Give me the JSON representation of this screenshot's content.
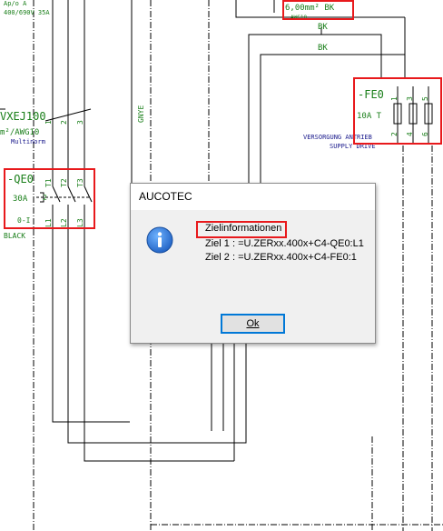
{
  "schematic": {
    "top_partial_1": "Ap/o A",
    "top_partial_2": "400/690V 35A",
    "wire_size": "6,00mm² BK",
    "wire_awg": "AWG10",
    "bk_1": "BK",
    "bk_2": "BK",
    "cable_id": "VXEJ100",
    "cable_awg": "m²/AWG10",
    "cable_maker": "Multinorm",
    "cable_cores": [
      "1",
      "2",
      "3"
    ],
    "gnye": "GNYE",
    "fuse_id": "-FE0",
    "fuse_rating": "10A T",
    "fuse_top": [
      "1",
      "3",
      "5"
    ],
    "fuse_bottom": [
      "2",
      "4",
      "6"
    ],
    "supply_de": "VERSORGUNG ANTRIEB",
    "supply_en": "SUPPLY DRIVE",
    "qe_id": "-QE0",
    "qe_rating": "30A",
    "qe_range": "0-I",
    "qe_color": "BLACK",
    "qe_top": [
      "T1",
      "T2",
      "T3"
    ],
    "qe_bottom": [
      "L1",
      "L2",
      "L3"
    ],
    "qe_contact": "2"
  },
  "dialog": {
    "title": "AUCOTEC",
    "heading": "Zielinformationen",
    "line1": "Ziel 1 : =U.ZERxx.400x+C4-QE0:L1",
    "line2": "Ziel 2 : =U.ZERxx.400x+C4-FE0:1",
    "ok_label": "Ok",
    "icon": "information-icon"
  },
  "colors": {
    "wire": "#000000",
    "label_green": "#1a7f1a",
    "label_blue": "#1a1a8c",
    "highlight": "#e8191c",
    "dialog_bg": "#f0f0f0",
    "accent": "#0078d7"
  }
}
